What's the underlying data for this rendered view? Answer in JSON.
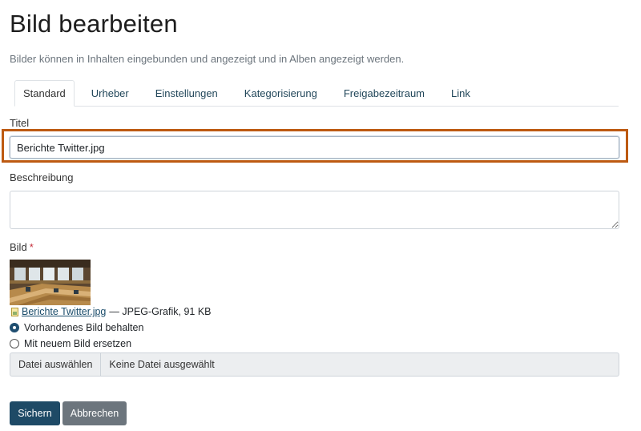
{
  "page": {
    "title": "Bild bearbeiten",
    "subtitle": "Bilder können in Inhalten eingebunden und angezeigt und in Alben angezeigt werden."
  },
  "tabs": [
    {
      "label": "Standard",
      "active": true
    },
    {
      "label": "Urheber",
      "active": false
    },
    {
      "label": "Einstellungen",
      "active": false
    },
    {
      "label": "Kategorisierung",
      "active": false
    },
    {
      "label": "Freigabezeitraum",
      "active": false
    },
    {
      "label": "Link",
      "active": false
    }
  ],
  "form": {
    "title_label": "Titel",
    "title_value": "Berichte Twitter.jpg",
    "description_label": "Beschreibung",
    "description_value": "",
    "image_label": "Bild",
    "required_mark": "*",
    "file_link": "Berichte Twitter.jpg",
    "file_meta": " — JPEG-Grafik, 91 KB",
    "radio_keep": "Vorhandenes Bild behalten",
    "radio_replace": "Mit neuem Bild ersetzen",
    "file_button": "Datei auswählen",
    "file_status": "Keine Datei ausgewählt"
  },
  "buttons": {
    "save": "Sichern",
    "cancel": "Abbrechen"
  },
  "colors": {
    "highlight": "#bd5a12",
    "primary": "#1e4a66",
    "secondary": "#6c757d"
  }
}
